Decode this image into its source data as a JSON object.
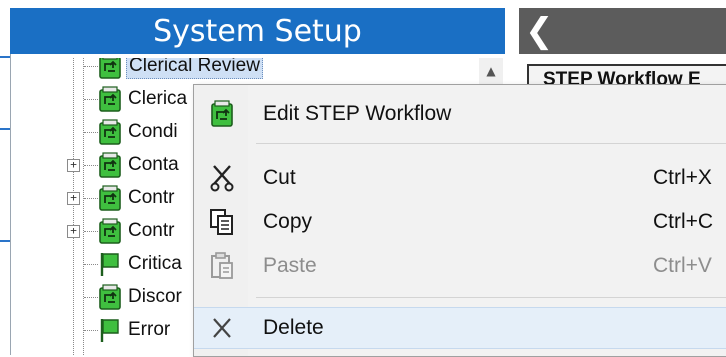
{
  "left_panel": {
    "title": "System Setup",
    "tree": [
      {
        "label": "Clerical Review",
        "icon": "workflow-icon",
        "selected": true,
        "expander": false
      },
      {
        "label": "Clerica",
        "icon": "workflow-icon",
        "selected": false,
        "expander": false
      },
      {
        "label": "Condi",
        "icon": "workflow-icon",
        "selected": false,
        "expander": false
      },
      {
        "label": "Conta",
        "icon": "workflow-icon",
        "selected": false,
        "expander": true
      },
      {
        "label": "Contr",
        "icon": "workflow-icon",
        "selected": false,
        "expander": true
      },
      {
        "label": "Contr",
        "icon": "workflow-icon",
        "selected": false,
        "expander": true
      },
      {
        "label": "Critica",
        "icon": "flag-icon",
        "selected": false,
        "expander": false
      },
      {
        "label": "Discor",
        "icon": "workflow-icon",
        "selected": false,
        "expander": false
      },
      {
        "label": "Error",
        "icon": "flag-icon",
        "selected": false,
        "expander": false
      }
    ]
  },
  "right_panel": {
    "back_glyph": "❮",
    "tab_label": "STEP Workflow E"
  },
  "context_menu": {
    "items": [
      {
        "label": "Edit STEP Workflow",
        "shortcut": "",
        "icon": "workflow-icon",
        "disabled": false
      },
      {
        "label": "Cut",
        "shortcut": "Ctrl+X",
        "icon": "scissors-icon",
        "disabled": false
      },
      {
        "label": "Copy",
        "shortcut": "Ctrl+C",
        "icon": "copy-icon",
        "disabled": false
      },
      {
        "label": "Paste",
        "shortcut": "Ctrl+V",
        "icon": "paste-icon",
        "disabled": true
      },
      {
        "label": "Delete",
        "shortcut": "",
        "icon": "delete-icon",
        "disabled": false,
        "highlighted": true
      }
    ]
  },
  "colors": {
    "header_blue": "#1a6fc4",
    "right_header_gray": "#5c5c5c",
    "icon_green": "#3fbf3f",
    "selection": "#cfe0f5"
  }
}
